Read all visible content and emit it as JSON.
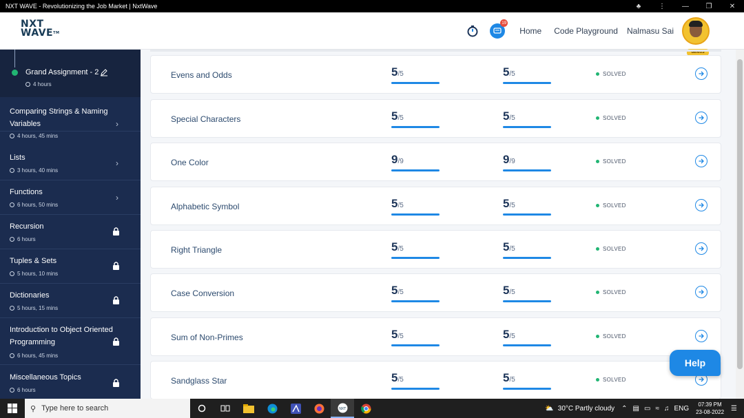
{
  "window": {
    "title": "NXT WAVE - Revolutionizing the Job Market | NxtWave"
  },
  "header": {
    "logo_line1": "NXT",
    "logo_line2": "WAVE",
    "logo_tm": "TM",
    "notification_count": "19",
    "nav_home": "Home",
    "nav_playground": "Code Playground",
    "user_name": "Nalmasu Sai",
    "badge": "GENIUS"
  },
  "sidebar": {
    "active": {
      "title": "Grand Assignment - 2",
      "duration": "4 hours"
    },
    "topics": [
      {
        "name": "Comparing Strings & Naming Variables",
        "duration": "4 hours, 45 mins",
        "state": "open"
      },
      {
        "name": "Lists",
        "duration": "3 hours, 40 mins",
        "state": "open"
      },
      {
        "name": "Functions",
        "duration": "6 hours, 50 mins",
        "state": "open"
      },
      {
        "name": "Recursion",
        "duration": "6 hours",
        "state": "locked"
      },
      {
        "name": "Tuples & Sets",
        "duration": "5 hours, 10 mins",
        "state": "locked"
      },
      {
        "name": "Dictionaries",
        "duration": "5 hours, 15 mins",
        "state": "locked"
      },
      {
        "name": "Introduction to Object Oriented Programming",
        "duration": "6 hours, 45 mins",
        "state": "locked"
      },
      {
        "name": "Miscellaneous Topics",
        "duration": "6 hours",
        "state": "locked"
      }
    ]
  },
  "questions": [
    {
      "name": "Evens and Odds",
      "score": "5",
      "max": "/5",
      "best": "5",
      "best_max": "/5",
      "status": "SOLVED"
    },
    {
      "name": "Special Characters",
      "score": "5",
      "max": "/5",
      "best": "5",
      "best_max": "/5",
      "status": "SOLVED"
    },
    {
      "name": "One Color",
      "score": "9",
      "max": "/9",
      "best": "9",
      "best_max": "/9",
      "status": "SOLVED"
    },
    {
      "name": "Alphabetic Symbol",
      "score": "5",
      "max": "/5",
      "best": "5",
      "best_max": "/5",
      "status": "SOLVED"
    },
    {
      "name": "Right Triangle",
      "score": "5",
      "max": "/5",
      "best": "5",
      "best_max": "/5",
      "status": "SOLVED"
    },
    {
      "name": "Case Conversion",
      "score": "5",
      "max": "/5",
      "best": "5",
      "best_max": "/5",
      "status": "SOLVED"
    },
    {
      "name": "Sum of Non-Primes",
      "score": "5",
      "max": "/5",
      "best": "5",
      "best_max": "/5",
      "status": "SOLVED"
    },
    {
      "name": "Sandglass Star",
      "score": "5",
      "max": "/5",
      "best": "5",
      "best_max": "/5",
      "status": "SOLVED"
    }
  ],
  "help_label": "Help",
  "taskbar": {
    "search_placeholder": "Type here to search",
    "weather": "30°C  Partly cloudy",
    "lang": "ENG",
    "time": "07:39 PM",
    "date": "23-08-2022"
  },
  "colors": {
    "accent": "#1e88e5",
    "sidebar": "#1b2c4f",
    "solved": "#21b573"
  }
}
